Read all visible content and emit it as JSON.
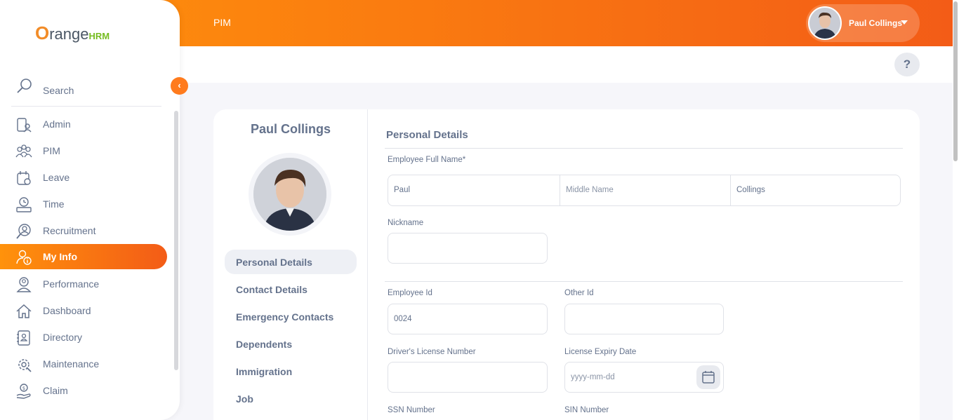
{
  "brand": {
    "logo_o": "O",
    "logo_range": "range",
    "logo_hrm": "HRM"
  },
  "header": {
    "title": "PIM",
    "user_name": "Paul Collings",
    "help_label": "?"
  },
  "sidebar": {
    "search_label": "Search",
    "collapse_label": "‹",
    "items": [
      {
        "label": "Admin",
        "icon": "admin-icon"
      },
      {
        "label": "PIM",
        "icon": "pim-icon"
      },
      {
        "label": "Leave",
        "icon": "leave-icon"
      },
      {
        "label": "Time",
        "icon": "time-icon"
      },
      {
        "label": "Recruitment",
        "icon": "recruitment-icon"
      },
      {
        "label": "My Info",
        "icon": "myinfo-icon",
        "active": true
      },
      {
        "label": "Performance",
        "icon": "performance-icon"
      },
      {
        "label": "Dashboard",
        "icon": "dashboard-icon"
      },
      {
        "label": "Directory",
        "icon": "directory-icon"
      },
      {
        "label": "Maintenance",
        "icon": "maintenance-icon"
      },
      {
        "label": "Claim",
        "icon": "claim-icon"
      }
    ]
  },
  "profile": {
    "name": "Paul Collings",
    "tabs": [
      {
        "label": "Personal Details",
        "active": true
      },
      {
        "label": "Contact Details"
      },
      {
        "label": "Emergency Contacts"
      },
      {
        "label": "Dependents"
      },
      {
        "label": "Immigration"
      },
      {
        "label": "Job"
      }
    ]
  },
  "form": {
    "section_title": "Personal Details",
    "full_name_label": "Employee Full Name*",
    "first_name": "Paul",
    "middle_name_placeholder": "Middle Name",
    "last_name": "Collings",
    "nickname_label": "Nickname",
    "nickname_value": "",
    "employee_id_label": "Employee Id",
    "employee_id_value": "0024",
    "other_id_label": "Other Id",
    "other_id_value": "",
    "license_label": "Driver's License Number",
    "license_value": "",
    "license_expiry_label": "License Expiry Date",
    "license_expiry_placeholder": "yyyy-mm-dd",
    "ssn_label": "SSN Number",
    "sin_label": "SIN Number"
  },
  "colors": {
    "accent": "#ff7b1d",
    "gradient_start": "#ff920b",
    "gradient_end": "#f35c17",
    "brand_green": "#76bc21"
  }
}
